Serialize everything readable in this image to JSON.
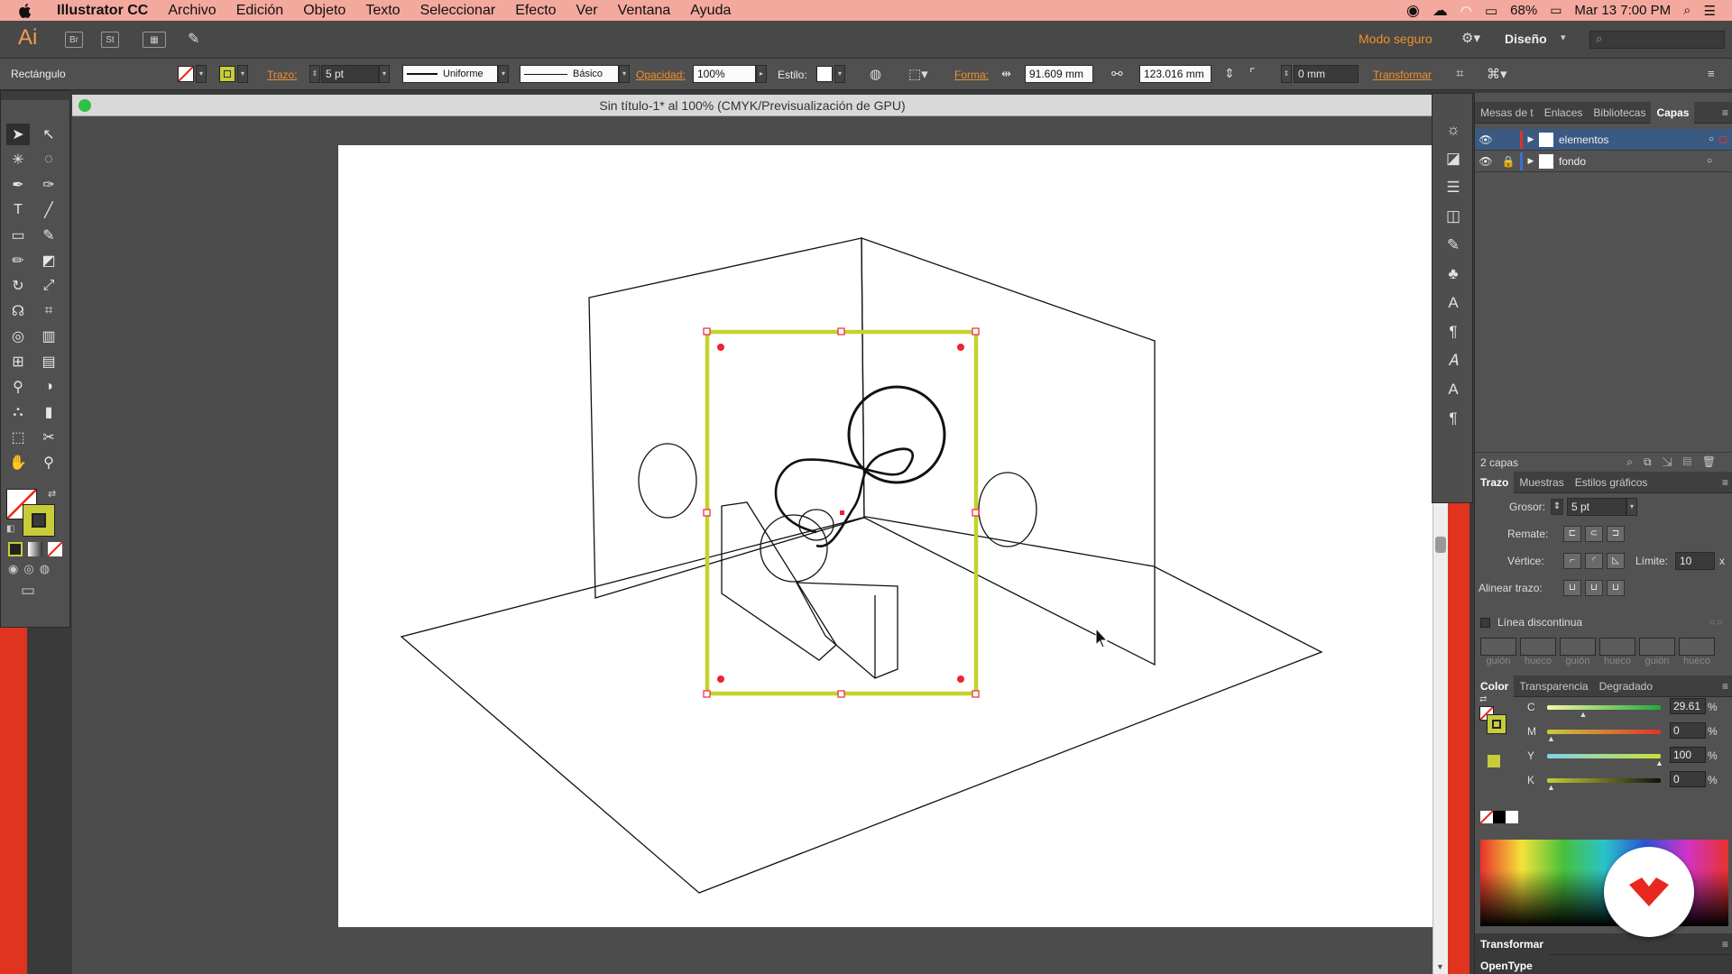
{
  "menubar": {
    "app_name": "Illustrator CC",
    "items": [
      "Archivo",
      "Edición",
      "Objeto",
      "Texto",
      "Seleccionar",
      "Efecto",
      "Ver",
      "Ventana",
      "Ayuda"
    ],
    "battery": "68%",
    "datetime": "Mar 13  7:00 PM"
  },
  "appbar": {
    "logo": "Ai",
    "bridge_label": "Br",
    "stock_label": "St",
    "safe_mode": "Modo seguro",
    "workspace": "Diseño"
  },
  "control": {
    "selection_type": "Rectángulo",
    "stroke_label": "Trazo:",
    "stroke_value": "5 pt",
    "profile": "Uniforme",
    "brush": "Básico",
    "opacity_label": "Opacidad:",
    "opacity_value": "100%",
    "style_label": "Estilo:",
    "shape_label": "Forma:",
    "width_value": "91.609 mm",
    "height_value": "123.016 mm",
    "corner_value": "0 mm",
    "transform_label": "Transformar"
  },
  "document": {
    "title": "Sin título-1* al 100% (CMYK/Previsualización de GPU)"
  },
  "layers_panel": {
    "tabs": [
      "Mesas de t",
      "Enlaces",
      "Bibliotecas",
      "Capas"
    ],
    "active_tab": "Capas",
    "layers": [
      {
        "name": "elementos",
        "color": "#d9342b"
      },
      {
        "name": "fondo",
        "color": "#3b6fd4"
      }
    ],
    "count": "2 capas"
  },
  "stroke_panel": {
    "tabs": [
      "Trazo",
      "Muestras",
      "Estilos gráficos"
    ],
    "weight_label": "Grosor:",
    "weight_value": "5 pt",
    "cap_label": "Remate:",
    "corner_label": "Vértice:",
    "limit_label": "Límite:",
    "limit_value": "10",
    "limit_unit": "x",
    "align_label": "Alinear trazo:",
    "dashed_label": "Línea discontinua",
    "dash_labels": [
      "guión",
      "hueco",
      "guión",
      "hueco",
      "guión",
      "hueco"
    ]
  },
  "color_panel": {
    "tabs": [
      "Color",
      "Transparencia",
      "Degradado"
    ],
    "channels": [
      {
        "label": "C",
        "value": "29.61",
        "unit": "%",
        "fraction": 0.2961
      },
      {
        "label": "M",
        "value": "0",
        "unit": "%",
        "fraction": 0
      },
      {
        "label": "Y",
        "value": "100",
        "unit": "%",
        "fraction": 1
      },
      {
        "label": "K",
        "value": "0",
        "unit": "%",
        "fraction": 0
      }
    ],
    "fill_color": "#c8cc3a"
  },
  "bottom_panels": {
    "transform": "Transformar",
    "opentype": "OpenType"
  },
  "colors": {
    "selection": "#c4d22b",
    "accent_orange": "#f0902a",
    "layer_highlight": "#3a5a82"
  }
}
